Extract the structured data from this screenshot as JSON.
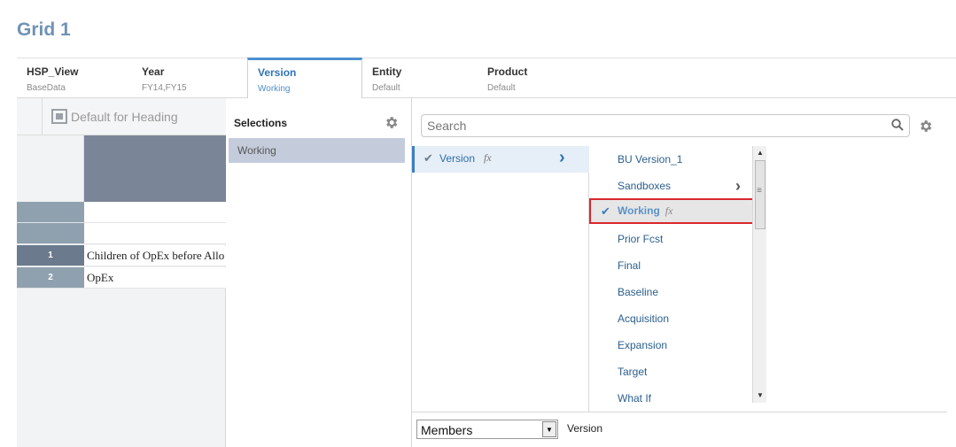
{
  "page_title": "Grid 1",
  "dimensions": [
    {
      "name": "HSP_View",
      "value": "BaseData"
    },
    {
      "name": "Year",
      "value": "FY14,FY15"
    },
    {
      "name": "Version",
      "value": "Working",
      "active": true
    },
    {
      "name": "Entity",
      "value": "Default"
    },
    {
      "name": "Product",
      "value": "Default"
    }
  ],
  "grid": {
    "heading_label": "Default for Heading",
    "rows": [
      {
        "number": "1",
        "label": "Children of OpEx before Allo"
      },
      {
        "number": "2",
        "label": "OpEx"
      }
    ]
  },
  "selections": {
    "heading": "Selections",
    "items": [
      "Working"
    ]
  },
  "member_selector": {
    "search_placeholder": "Search",
    "nav_item": {
      "label": "Version",
      "fx": "fx"
    },
    "members": [
      {
        "label": "BU Version_1"
      },
      {
        "label": "Sandboxes",
        "has_children": true
      },
      {
        "label": "Working",
        "fx": "fx",
        "selected": true
      },
      {
        "label": "Prior Fcst"
      },
      {
        "label": "Final"
      },
      {
        "label": "Baseline"
      },
      {
        "label": "Acquisition"
      },
      {
        "label": "Expansion"
      },
      {
        "label": "Target"
      },
      {
        "label": "What If"
      }
    ],
    "view_select": "Members",
    "footer_label": "Version"
  },
  "colors": {
    "title": "#6f92b4",
    "accent": "#4c8fcf",
    "selection_highlight": "#d9272d",
    "grid_header": "#7a8597"
  },
  "icons": [
    "gear-icon",
    "search-icon",
    "check-icon",
    "chevron-right-icon",
    "heading-icon"
  ]
}
